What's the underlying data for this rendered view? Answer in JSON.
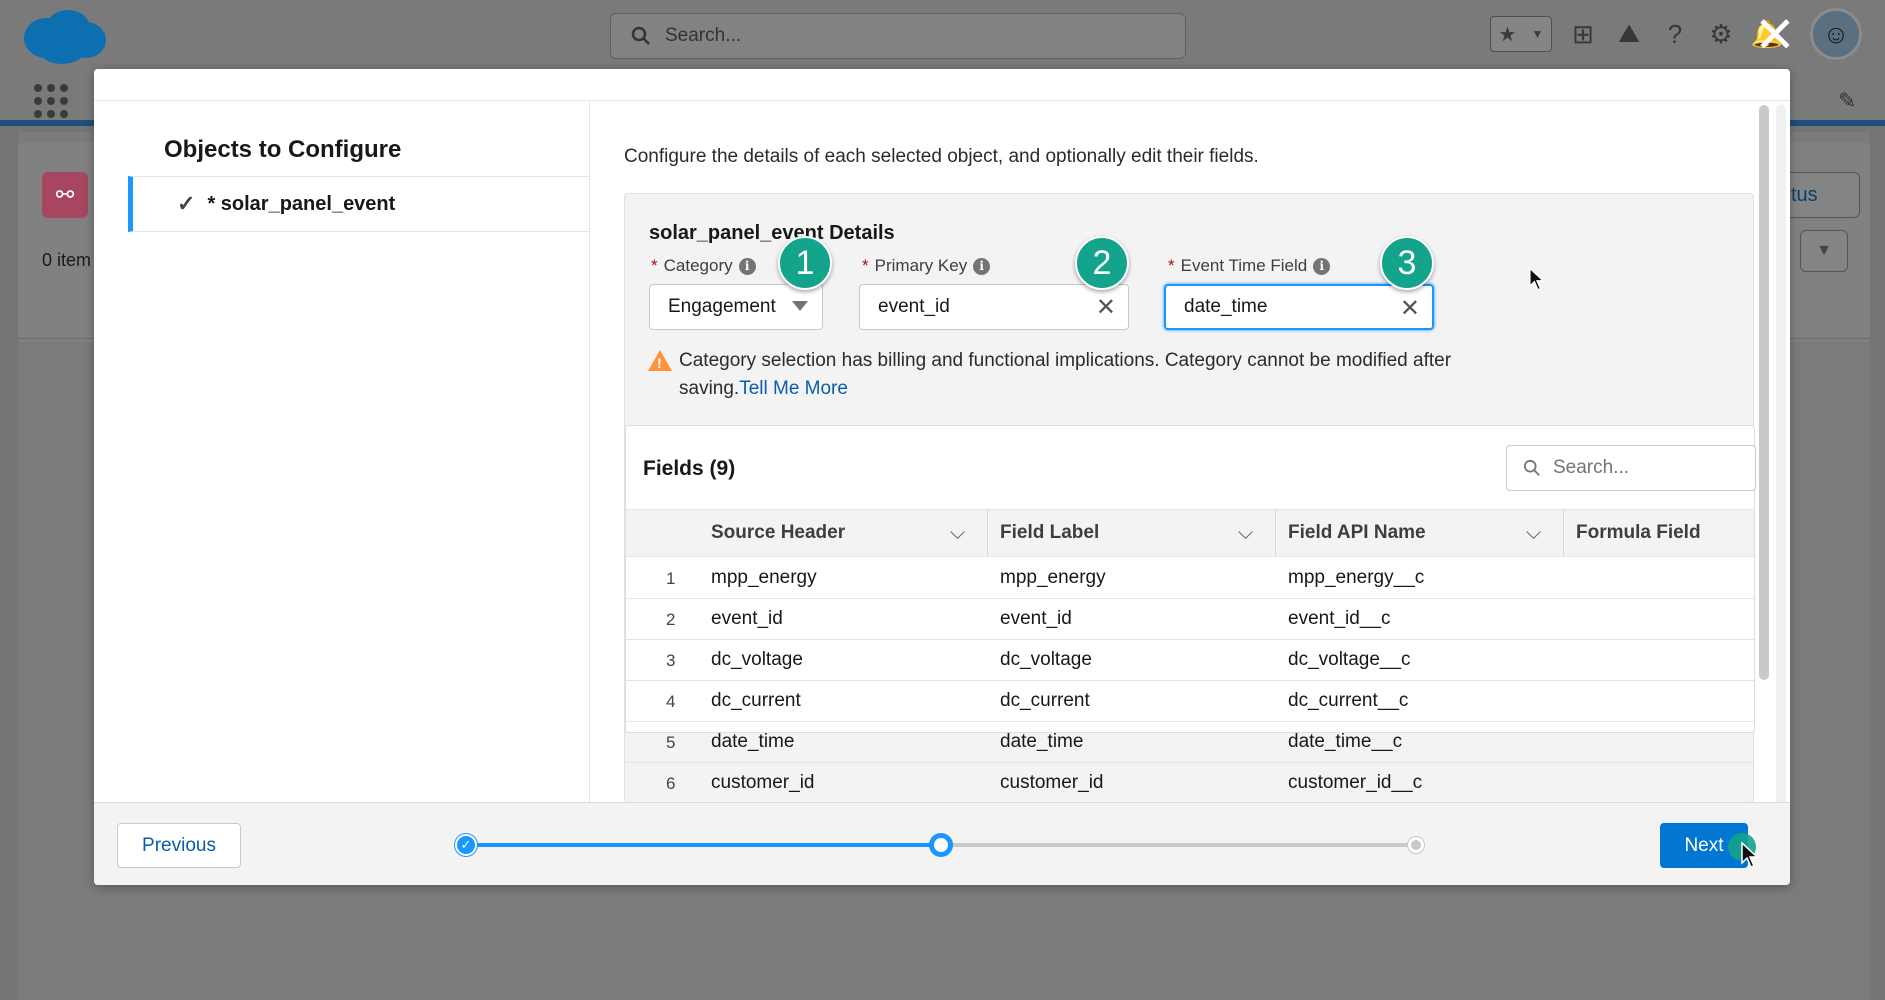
{
  "header": {
    "search_placeholder": "Search...",
    "close_label": "✕"
  },
  "background": {
    "items_count": "0 item",
    "status_button": "tus"
  },
  "left_panel": {
    "title": "Objects to Configure",
    "items": [
      {
        "label": "* solar_panel_event",
        "selected": true
      }
    ]
  },
  "main": {
    "intro": "Configure the details of each selected object, and optionally edit their fields.",
    "details_title": "solar_panel_event Details",
    "category": {
      "label": "Category",
      "value": "Engagement",
      "badge": "1"
    },
    "primary_key": {
      "label": "Primary Key",
      "value": "event_id",
      "badge": "2"
    },
    "event_time": {
      "label": "Event Time Field",
      "value": "date_time",
      "badge": "3"
    },
    "warning_text": "Category selection has billing and functional implications. Category cannot be modified after saving.",
    "warning_link": "Tell Me More",
    "fields": {
      "title": "Fields (9)",
      "search_placeholder": "Search...",
      "columns": [
        "Source Header",
        "Field Label",
        "Field API Name",
        "Formula Field"
      ],
      "rows": [
        {
          "num": "1",
          "source": "mpp_energy",
          "label": "mpp_energy",
          "api": "mpp_energy__c"
        },
        {
          "num": "2",
          "source": "event_id",
          "label": "event_id",
          "api": "event_id__c"
        },
        {
          "num": "3",
          "source": "dc_voltage",
          "label": "dc_voltage",
          "api": "dc_voltage__c"
        },
        {
          "num": "4",
          "source": "dc_current",
          "label": "dc_current",
          "api": "dc_current__c"
        },
        {
          "num": "5",
          "source": "date_time",
          "label": "date_time",
          "api": "date_time__c"
        },
        {
          "num": "6",
          "source": "customer_id",
          "label": "customer_id",
          "api": "customer_id__c"
        }
      ]
    }
  },
  "footer": {
    "previous_label": "Previous",
    "next_label": "Next",
    "progress_step": 2,
    "progress_total": 3
  },
  "colors": {
    "brand": "#0176d3",
    "accent": "#1b96ff",
    "badge": "#14a38b",
    "warning": "#fe9339"
  }
}
